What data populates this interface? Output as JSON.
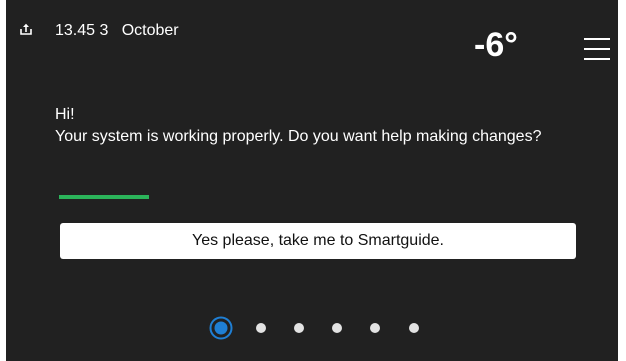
{
  "status_bar": {
    "date_time": "13.45 3   October",
    "outdoor_temperature": "-6°",
    "usb_icon": "usb-upload-icon",
    "menu_icon": "hamburger-menu-icon"
  },
  "message": {
    "greeting": "Hi!",
    "text": "Your system is working properly. Do you want help making changes?"
  },
  "cta": {
    "label": "Yes please, take me to Smartguide."
  },
  "pager": {
    "total_pages": 6,
    "current_page": 1
  },
  "colors": {
    "background": "#212121",
    "accent_green": "#2bb45a",
    "active_dot": "#1f7fd4",
    "text": "#ffffff"
  }
}
